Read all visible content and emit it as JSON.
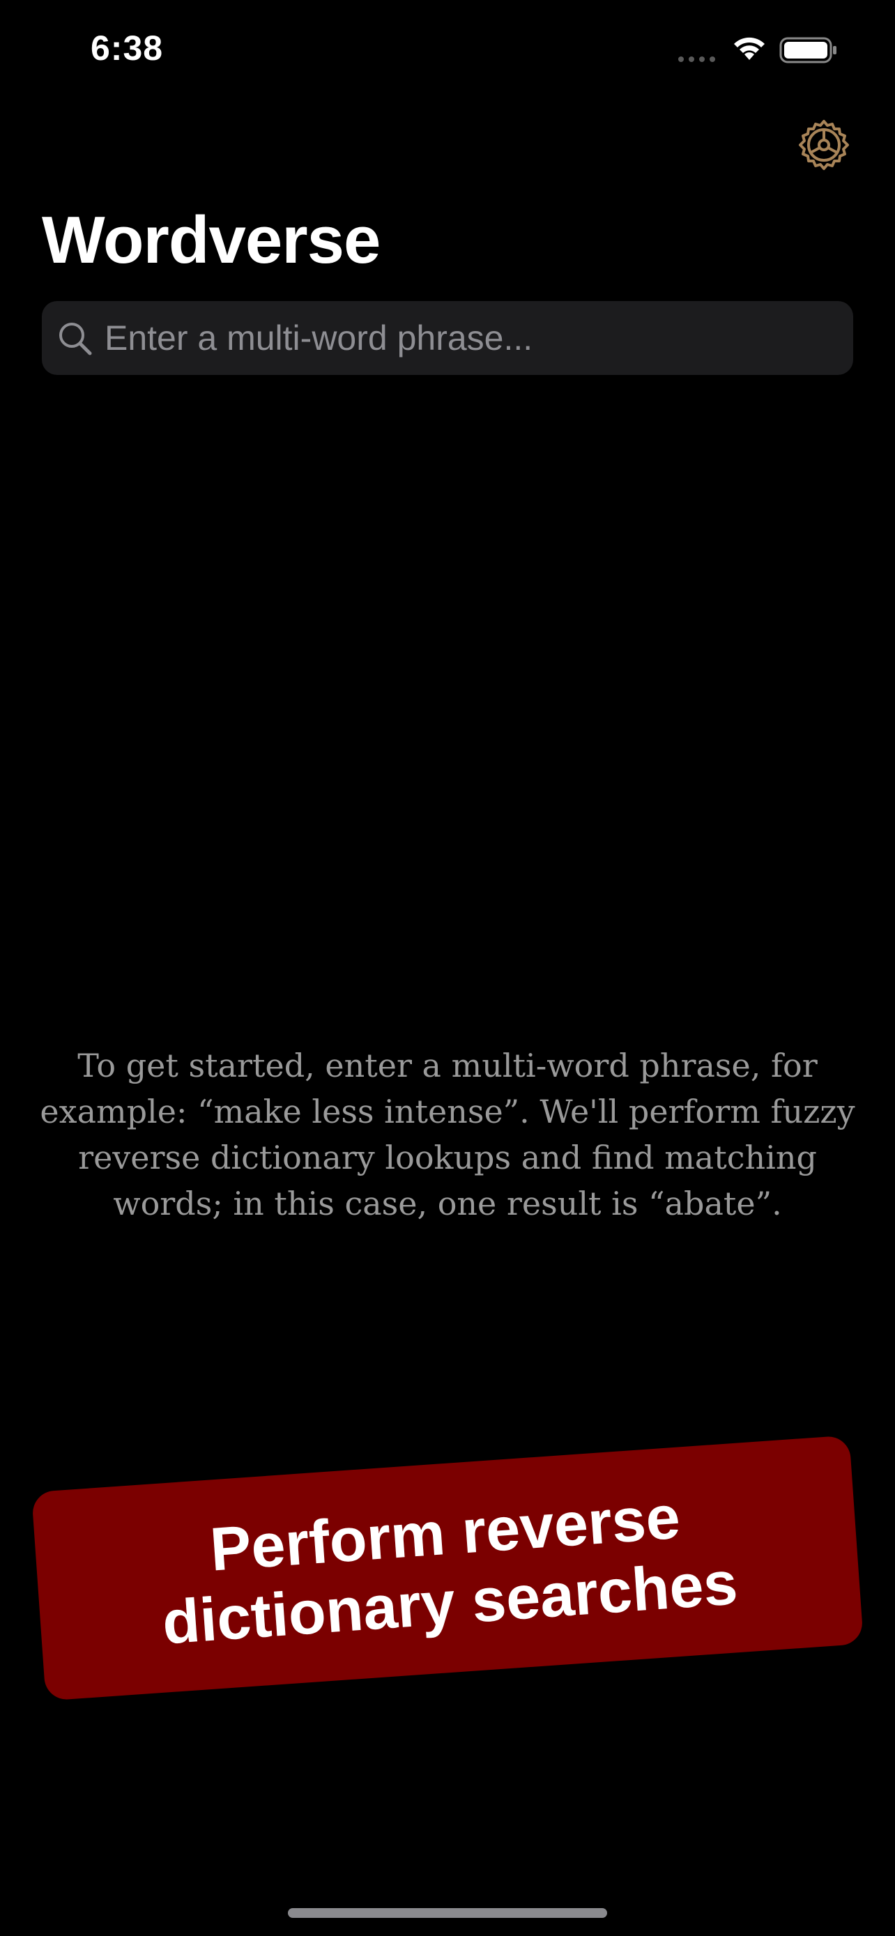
{
  "status_bar": {
    "time": "6:38"
  },
  "header": {
    "settings_icon": "gear-icon",
    "accent_color": "#a88458"
  },
  "app": {
    "title": "Wordverse"
  },
  "search": {
    "placeholder": "Enter a multi-word phrase...",
    "value": "",
    "icon": "search-icon"
  },
  "empty_state": {
    "text": "To get started, enter a multi-word phrase, for example: “make less intense”. We'll perform fuzzy reverse dictionary lookups and find matching words; in this case, one result is “abate”."
  },
  "promo": {
    "text": "Perform reverse dictionary searches",
    "background": "#7b0000"
  }
}
